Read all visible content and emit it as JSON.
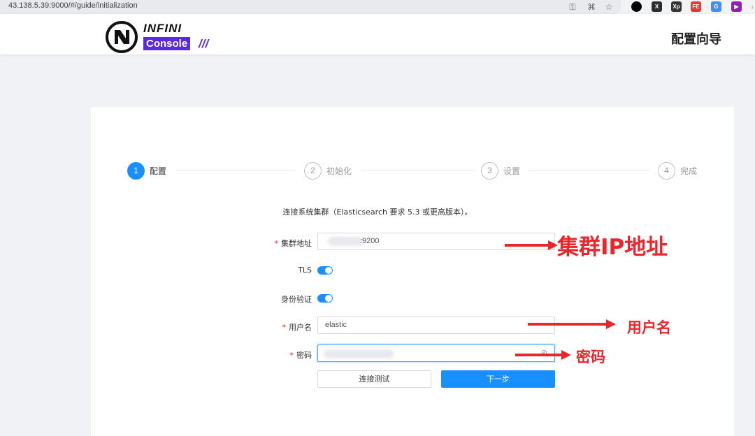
{
  "browser": {
    "url": "43.138.5.39:9000/#/guide/initialization",
    "extensions": [
      {
        "name": "record-ext",
        "text": "",
        "color": "#000000"
      },
      {
        "name": "x-ext",
        "text": "X",
        "color": "#2d2d2d"
      },
      {
        "name": "xp-ext",
        "text": "Xp",
        "color": "#333333"
      },
      {
        "name": "fe-ext",
        "text": "FE",
        "color": "#e53935"
      },
      {
        "name": "translate-ext",
        "text": "G",
        "color": "#4a8af4"
      },
      {
        "name": "play-ext",
        "text": "▶",
        "color": "#8e24aa"
      }
    ]
  },
  "header": {
    "logo_top": "INFINI",
    "logo_bottom": "Console",
    "logo_slash": "///",
    "title": "配置向导"
  },
  "steps": [
    {
      "num": "1",
      "label": "配置",
      "active": true
    },
    {
      "num": "2",
      "label": "初始化",
      "active": false
    },
    {
      "num": "3",
      "label": "设置",
      "active": false
    },
    {
      "num": "4",
      "label": "完成",
      "active": false
    }
  ],
  "form": {
    "description": "连接系统集群（Elasticsearch 要求 5.3 或更高版本）。",
    "cluster_label": "集群地址",
    "cluster_value": ":9200",
    "tls_label": "TLS",
    "tls_enabled": true,
    "auth_label": "身份验证",
    "auth_enabled": true,
    "username_label": "用户名",
    "username_value": "elastic",
    "password_label": "密码",
    "required_mark": "*",
    "test_button": "连接测试",
    "next_button": "下一步"
  },
  "annotations": {
    "cluster_ip": "集群IP地址",
    "username": "用户名",
    "password": "密码",
    "color": "#e8262b"
  }
}
